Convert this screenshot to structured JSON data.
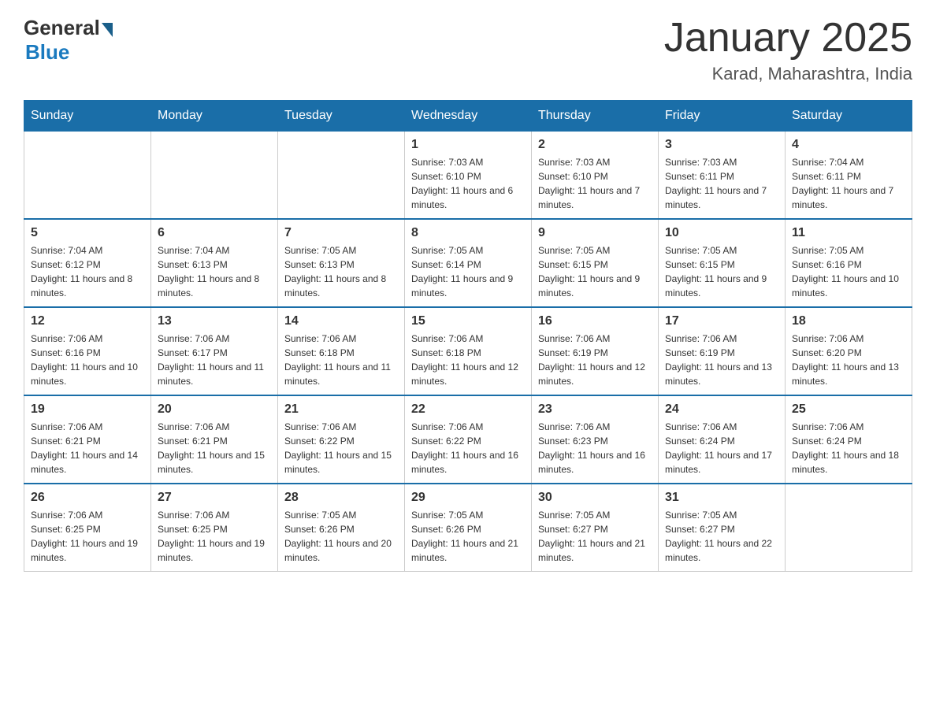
{
  "header": {
    "logo_general": "General",
    "logo_blue": "Blue",
    "month_title": "January 2025",
    "location": "Karad, Maharashtra, India"
  },
  "days_of_week": [
    "Sunday",
    "Monday",
    "Tuesday",
    "Wednesday",
    "Thursday",
    "Friday",
    "Saturday"
  ],
  "weeks": [
    [
      {
        "day": "",
        "info": ""
      },
      {
        "day": "",
        "info": ""
      },
      {
        "day": "",
        "info": ""
      },
      {
        "day": "1",
        "info": "Sunrise: 7:03 AM\nSunset: 6:10 PM\nDaylight: 11 hours and 6 minutes."
      },
      {
        "day": "2",
        "info": "Sunrise: 7:03 AM\nSunset: 6:10 PM\nDaylight: 11 hours and 7 minutes."
      },
      {
        "day": "3",
        "info": "Sunrise: 7:03 AM\nSunset: 6:11 PM\nDaylight: 11 hours and 7 minutes."
      },
      {
        "day": "4",
        "info": "Sunrise: 7:04 AM\nSunset: 6:11 PM\nDaylight: 11 hours and 7 minutes."
      }
    ],
    [
      {
        "day": "5",
        "info": "Sunrise: 7:04 AM\nSunset: 6:12 PM\nDaylight: 11 hours and 8 minutes."
      },
      {
        "day": "6",
        "info": "Sunrise: 7:04 AM\nSunset: 6:13 PM\nDaylight: 11 hours and 8 minutes."
      },
      {
        "day": "7",
        "info": "Sunrise: 7:05 AM\nSunset: 6:13 PM\nDaylight: 11 hours and 8 minutes."
      },
      {
        "day": "8",
        "info": "Sunrise: 7:05 AM\nSunset: 6:14 PM\nDaylight: 11 hours and 9 minutes."
      },
      {
        "day": "9",
        "info": "Sunrise: 7:05 AM\nSunset: 6:15 PM\nDaylight: 11 hours and 9 minutes."
      },
      {
        "day": "10",
        "info": "Sunrise: 7:05 AM\nSunset: 6:15 PM\nDaylight: 11 hours and 9 minutes."
      },
      {
        "day": "11",
        "info": "Sunrise: 7:05 AM\nSunset: 6:16 PM\nDaylight: 11 hours and 10 minutes."
      }
    ],
    [
      {
        "day": "12",
        "info": "Sunrise: 7:06 AM\nSunset: 6:16 PM\nDaylight: 11 hours and 10 minutes."
      },
      {
        "day": "13",
        "info": "Sunrise: 7:06 AM\nSunset: 6:17 PM\nDaylight: 11 hours and 11 minutes."
      },
      {
        "day": "14",
        "info": "Sunrise: 7:06 AM\nSunset: 6:18 PM\nDaylight: 11 hours and 11 minutes."
      },
      {
        "day": "15",
        "info": "Sunrise: 7:06 AM\nSunset: 6:18 PM\nDaylight: 11 hours and 12 minutes."
      },
      {
        "day": "16",
        "info": "Sunrise: 7:06 AM\nSunset: 6:19 PM\nDaylight: 11 hours and 12 minutes."
      },
      {
        "day": "17",
        "info": "Sunrise: 7:06 AM\nSunset: 6:19 PM\nDaylight: 11 hours and 13 minutes."
      },
      {
        "day": "18",
        "info": "Sunrise: 7:06 AM\nSunset: 6:20 PM\nDaylight: 11 hours and 13 minutes."
      }
    ],
    [
      {
        "day": "19",
        "info": "Sunrise: 7:06 AM\nSunset: 6:21 PM\nDaylight: 11 hours and 14 minutes."
      },
      {
        "day": "20",
        "info": "Sunrise: 7:06 AM\nSunset: 6:21 PM\nDaylight: 11 hours and 15 minutes."
      },
      {
        "day": "21",
        "info": "Sunrise: 7:06 AM\nSunset: 6:22 PM\nDaylight: 11 hours and 15 minutes."
      },
      {
        "day": "22",
        "info": "Sunrise: 7:06 AM\nSunset: 6:22 PM\nDaylight: 11 hours and 16 minutes."
      },
      {
        "day": "23",
        "info": "Sunrise: 7:06 AM\nSunset: 6:23 PM\nDaylight: 11 hours and 16 minutes."
      },
      {
        "day": "24",
        "info": "Sunrise: 7:06 AM\nSunset: 6:24 PM\nDaylight: 11 hours and 17 minutes."
      },
      {
        "day": "25",
        "info": "Sunrise: 7:06 AM\nSunset: 6:24 PM\nDaylight: 11 hours and 18 minutes."
      }
    ],
    [
      {
        "day": "26",
        "info": "Sunrise: 7:06 AM\nSunset: 6:25 PM\nDaylight: 11 hours and 19 minutes."
      },
      {
        "day": "27",
        "info": "Sunrise: 7:06 AM\nSunset: 6:25 PM\nDaylight: 11 hours and 19 minutes."
      },
      {
        "day": "28",
        "info": "Sunrise: 7:05 AM\nSunset: 6:26 PM\nDaylight: 11 hours and 20 minutes."
      },
      {
        "day": "29",
        "info": "Sunrise: 7:05 AM\nSunset: 6:26 PM\nDaylight: 11 hours and 21 minutes."
      },
      {
        "day": "30",
        "info": "Sunrise: 7:05 AM\nSunset: 6:27 PM\nDaylight: 11 hours and 21 minutes."
      },
      {
        "day": "31",
        "info": "Sunrise: 7:05 AM\nSunset: 6:27 PM\nDaylight: 11 hours and 22 minutes."
      },
      {
        "day": "",
        "info": ""
      }
    ]
  ]
}
